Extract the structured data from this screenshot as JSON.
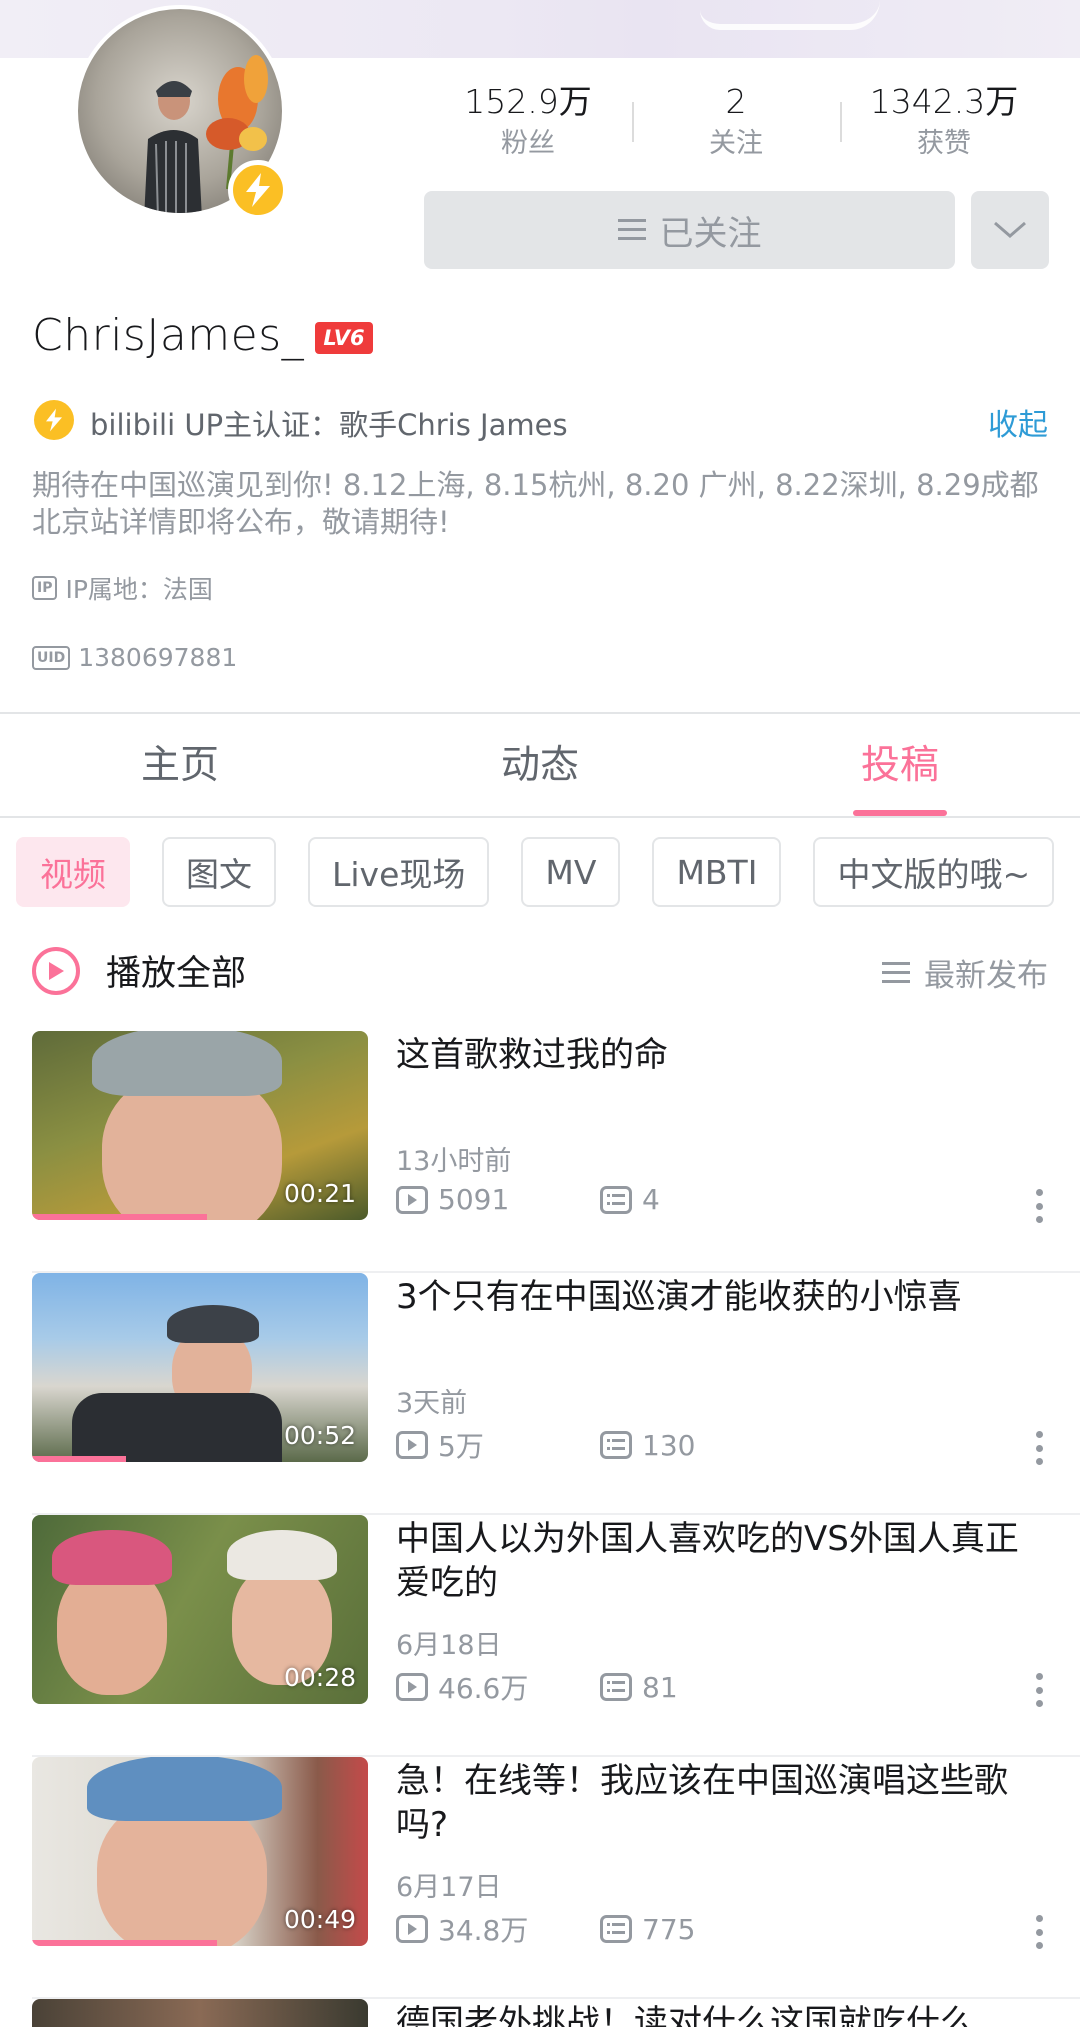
{
  "profile": {
    "username": "ChrisJames_",
    "level": "LV6",
    "certification": "bilibili UP主认证：歌手Chris James",
    "collapse_label": "收起",
    "bio_line1": "期待在中国巡演见到你! 8.12上海, 8.15杭州, 8.20 广州, 8.22深圳, 8.29成都",
    "bio_line2": "北京站详情即将公布，敬请期待!",
    "ip_tag": "IP",
    "ip_location": "IP属地：法国",
    "uid_tag": "UID",
    "uid": "1380697881"
  },
  "stats": [
    {
      "value": "152.9万",
      "label": "粉丝"
    },
    {
      "value": "2",
      "label": "关注"
    },
    {
      "value": "1342.3万",
      "label": "获赞"
    }
  ],
  "follow_button": "已关注",
  "tabs": [
    "主页",
    "动态",
    "投稿"
  ],
  "active_tab": "投稿",
  "chips": [
    "视频",
    "图文",
    "Live现场",
    "MV",
    "MBTI",
    "中文版的哦~"
  ],
  "playall_label": "播放全部",
  "sort_label": "最新发布",
  "videos": [
    {
      "title": "这首歌救过我的命",
      "date": "13小时前",
      "views": "5091",
      "comments": "4",
      "duration": "00:21",
      "progress": 0.52
    },
    {
      "title": "3个只有在中国巡演才能收获的小惊喜",
      "date": "3天前",
      "views": "5万",
      "comments": "130",
      "duration": "00:52",
      "progress": 0.28
    },
    {
      "title": "中国人以为外国人喜欢吃的VS外国人真正爱吃的",
      "date": "6月18日",
      "views": "46.6万",
      "comments": "81",
      "duration": "00:28",
      "progress": 0
    },
    {
      "title": "急！在线等！我应该在中国巡演唱这些歌吗?",
      "date": "6月17日",
      "views": "34.8万",
      "comments": "775",
      "duration": "00:49",
      "progress": 0.55
    },
    {
      "title": "德国老外挑战！读对什么这国就吃什么",
      "date": "",
      "views": "",
      "comments": "",
      "duration": "",
      "progress": 0
    }
  ],
  "colors": {
    "accent": "#fb7299",
    "link": "#2e9bd6",
    "badge": "#ef3b3b",
    "bolt": "#fbbf24"
  }
}
